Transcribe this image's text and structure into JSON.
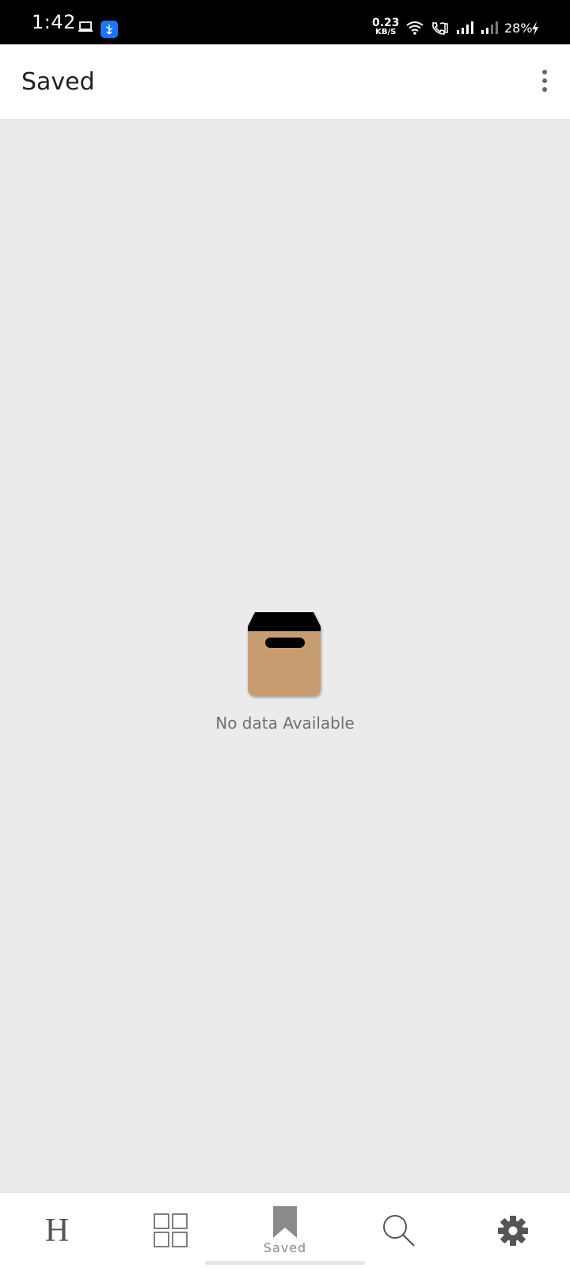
{
  "status_bar": {
    "time": "1:42",
    "speed_value": "0.23",
    "speed_unit": "KB/S",
    "battery": "28%",
    "icons": [
      "laptop-icon",
      "usb-icon",
      "wifi-icon",
      "wifi-calling-icon",
      "signal-icon",
      "signal-icon",
      "charging-icon"
    ]
  },
  "app_bar": {
    "title": "Saved",
    "menu_icon": "more-vert-icon"
  },
  "content": {
    "empty_text": "No data Available",
    "empty_icon": "archive-box-icon"
  },
  "bottom_nav": {
    "items": [
      {
        "icon": "h-letter-icon",
        "glyph": "H",
        "label": ""
      },
      {
        "icon": "grid-icon",
        "label": ""
      },
      {
        "icon": "bookmark-icon",
        "label": "Saved",
        "active": true
      },
      {
        "icon": "search-icon",
        "label": ""
      },
      {
        "icon": "gear-icon",
        "label": ""
      }
    ]
  },
  "colors": {
    "background": "#ebebeb",
    "app_bar": "#ffffff",
    "box": "#c69d6f",
    "box_lid": "#000000",
    "usb_badge": "#1677ff"
  }
}
